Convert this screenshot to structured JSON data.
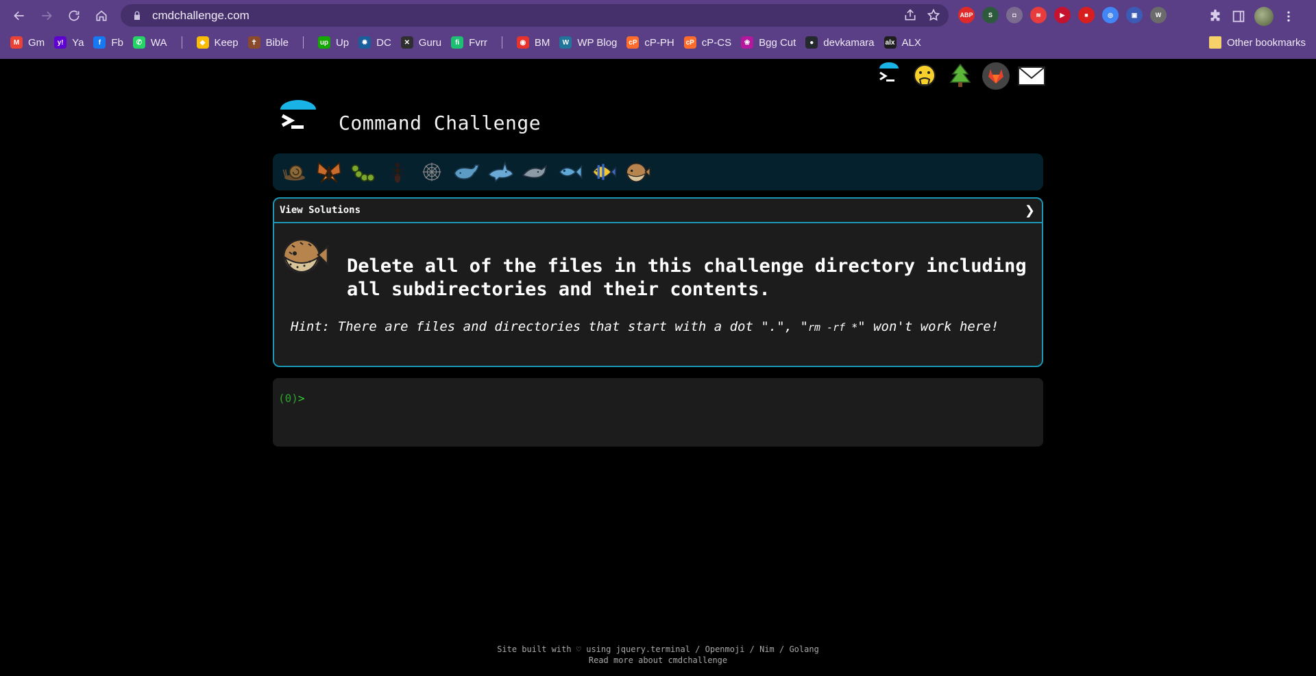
{
  "browser": {
    "url": "cmdchallenge.com",
    "bookmarks": [
      {
        "label": "Gm",
        "color": "#ea4335",
        "glyph": "M"
      },
      {
        "label": "Ya",
        "color": "#5f01d1",
        "glyph": "y!"
      },
      {
        "label": "Fb",
        "color": "#1877f2",
        "glyph": "f"
      },
      {
        "label": "WA",
        "color": "#25d366",
        "glyph": "✆"
      },
      {
        "label": "Keep",
        "color": "#fbbc04",
        "glyph": "◆"
      },
      {
        "label": "Bible",
        "color": "#8b4a2b",
        "glyph": "✝"
      },
      {
        "label": "Up",
        "color": "#14a800",
        "glyph": "up"
      },
      {
        "label": "DC",
        "color": "#1a5f9c",
        "glyph": "✹"
      },
      {
        "label": "Guru",
        "color": "#2f2f2f",
        "glyph": "✕"
      },
      {
        "label": "Fvrr",
        "color": "#1dbf73",
        "glyph": "fi"
      },
      {
        "label": "BM",
        "color": "#e8322c",
        "glyph": "◉"
      },
      {
        "label": "WP Blog",
        "color": "#21759b",
        "glyph": "W"
      },
      {
        "label": "cP-PH",
        "color": "#ff6c2c",
        "glyph": "cP"
      },
      {
        "label": "cP-CS",
        "color": "#ff6c2c",
        "glyph": "cP"
      },
      {
        "label": "Bgg Cut",
        "color": "#b5179e",
        "glyph": "❀"
      },
      {
        "label": "devkamara",
        "color": "#24292e",
        "glyph": "●"
      },
      {
        "label": "ALX",
        "color": "#1e1e1e",
        "glyph": "alx"
      }
    ],
    "other_bookmarks": "Other bookmarks",
    "extensions": [
      {
        "name": "abp-extension-icon",
        "color": "#e02a2a",
        "glyph": "ABP"
      },
      {
        "name": "s-extension-icon",
        "color": "#2d5a3d",
        "glyph": "S"
      },
      {
        "name": "camera-extension-icon",
        "color": "#7a6b8f",
        "glyph": "◘"
      },
      {
        "name": "ext-red-swirl-icon",
        "color": "#e83b3b",
        "glyph": "≋"
      },
      {
        "name": "ext-red-play-icon",
        "color": "#c4122f",
        "glyph": "▶"
      },
      {
        "name": "ext-record-icon",
        "color": "#d81e1e",
        "glyph": "■"
      },
      {
        "name": "chrome-circle-icon",
        "color": "#4285f4",
        "glyph": "◎"
      },
      {
        "name": "ext-blue-icon",
        "color": "#3b5bb5",
        "glyph": "▣"
      },
      {
        "name": "wordpress-extension-icon",
        "color": "#6b6b6b",
        "glyph": "W"
      }
    ]
  },
  "site": {
    "title": "Command Challenge",
    "view_solutions": "View Solutions",
    "challenge_text": "Delete all of the files in this challenge directory including all subdirectories and their contents.",
    "hint_prefix": "Hint: There are files and directories that start with a dot \".\", \"",
    "hint_code": "rm -rf *",
    "hint_suffix": "\" won't work here!",
    "prompt_num": "(0)",
    "prompt_arrow": ">",
    "footer_line1": "Site built with ♡ using jquery.terminal / Openmoji / Nim / Golang",
    "footer_line2": "Read more about cmdchallenge",
    "accent_color": "#1a98b6"
  }
}
